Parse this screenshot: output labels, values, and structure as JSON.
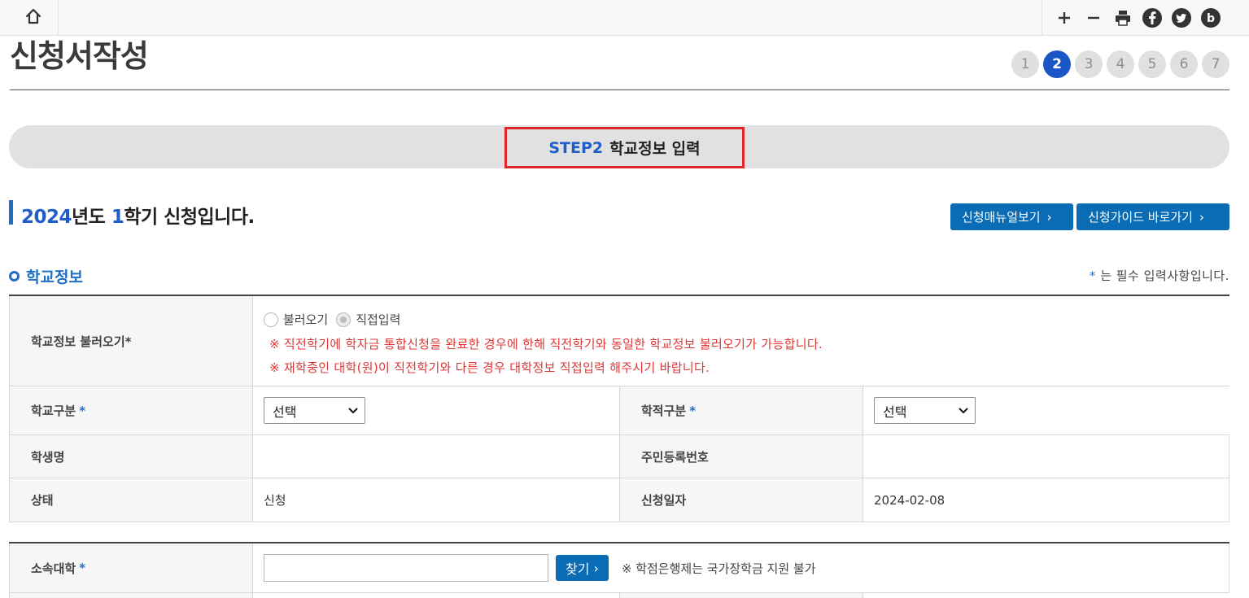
{
  "topbar": {
    "home_icon": "home-icon",
    "tools": [
      "plus-icon",
      "minus-icon",
      "print-icon",
      "facebook-icon",
      "twitter-icon",
      "blog-icon"
    ]
  },
  "page": {
    "title": "신청서작성",
    "steps": [
      "1",
      "2",
      "3",
      "4",
      "5",
      "6",
      "7"
    ],
    "active_step": "2"
  },
  "banner": {
    "step_no": "STEP2",
    "step_title": "학교정보 입력"
  },
  "semester": {
    "year": "2024",
    "year_suffix": "년도 ",
    "term": "1",
    "term_suffix": "학기 신청입니다."
  },
  "buttons": {
    "manual": "신청매뉴얼보기",
    "guide": "신청가이드 바로가기"
  },
  "section": {
    "title": "학교정보",
    "req_star": "*",
    "req_note": " 는 필수 입력사항입니다."
  },
  "school_info": {
    "load_label": "학교정보 불러오기*",
    "radio_load": "불러오기",
    "radio_direct": "직접입력",
    "warning1": "※ 직전학기에 학자금 통합신청을 완료한 경우에 한해 직전학기와 동일한 학교정보 불러오기가 가능합니다.",
    "warning2": "※ 재학중인 대학(원)이 직전학기와 다른 경우 대학정보 직접입력 해주시기 바랍니다.",
    "school_type_label": "학교구분",
    "school_type_value": "선택",
    "enroll_type_label": "학적구분",
    "enroll_type_value": "선택",
    "student_name_label": "학생명",
    "student_name_value": "",
    "rrn_label": "주민등록번호",
    "rrn_value": "",
    "status_label": "상태",
    "status_value": "신청",
    "apply_date_label": "신청일자",
    "apply_date_value": "2024-02-08"
  },
  "university": {
    "label": "소속대학",
    "input_value": "",
    "find_button": "찾기",
    "note": "※ 학점은행제는 국가장학금 지원 불가"
  },
  "colors": {
    "accent": "#1f6fc5",
    "button": "#0a6cb5",
    "active_step": "#1a56c7",
    "warning": "#e03535",
    "highlight_border": "#e3262e"
  }
}
